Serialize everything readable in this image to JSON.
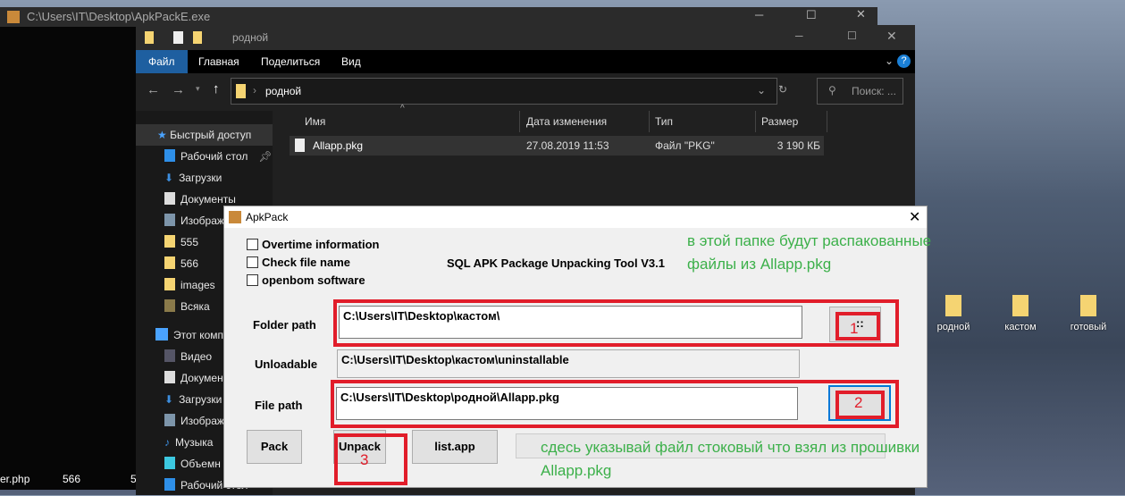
{
  "console": {
    "title": "C:\\Users\\IT\\Desktop\\ApkPackE.exe"
  },
  "explorer": {
    "title": "родной",
    "ribbon_tabs": [
      "Файл",
      "Главная",
      "Поделиться",
      "Вид"
    ],
    "address": "родной",
    "search_placeholder": "Поиск: ...",
    "columns": [
      "Имя",
      "Дата изменения",
      "Тип",
      "Размер"
    ],
    "files": [
      {
        "name": "Allapp.pkg",
        "date": "27.08.2019 11:53",
        "type": "Файл \"PKG\"",
        "size": "3 190 КБ"
      }
    ],
    "nav": [
      "Быстрый доступ",
      "Рабочий стол",
      "Загрузки",
      "Документы",
      "Изображ",
      "555",
      "566",
      "images",
      "Всяка",
      "Этот комп",
      "Видео",
      "Докумен",
      "Загрузки",
      "Изображ",
      "Музыка",
      "Объемн",
      "Рабочий стол"
    ],
    "accent": "#1e5fa0"
  },
  "dialog": {
    "title": "ApkPack",
    "checkboxes": [
      {
        "label": "Overtime information",
        "checked": false
      },
      {
        "label": "Check file name",
        "checked": false
      },
      {
        "label": "openbom software",
        "checked": false
      }
    ],
    "tool_name": "SQL APK Package Unpacking Tool V3.1",
    "folder_label": "Folder path",
    "folder_value": "C:\\Users\\IT\\Desktop\\кастом\\",
    "unloadable_label": "Unloadable",
    "unloadable_value": "C:\\Users\\IT\\Desktop\\кастом\\uninstallable",
    "file_label": "File path",
    "file_value": "C:\\Users\\IT\\Desktop\\родной\\Allapp.pkg",
    "browse_label": "::",
    "pack": "Pack",
    "unpack": "Unpack",
    "listapp": "list.app"
  },
  "annotations": {
    "note1_line1": "в этой папке будут распакованные",
    "note1_line2": "файлы из Allapp.pkg",
    "note2_line1": "сдесь указывай файл стоковый что взял из прошивки",
    "note2_line2": "Allapp.pkg",
    "n1": "1",
    "n2": "2",
    "n3": "3",
    "marker_color": "#e11d2a",
    "note_color": "#3cb04a"
  },
  "desktop": {
    "icons": [
      "родной",
      "кастом",
      "готовый"
    ],
    "bottom": [
      "er.php",
      "566",
      "5"
    ]
  }
}
